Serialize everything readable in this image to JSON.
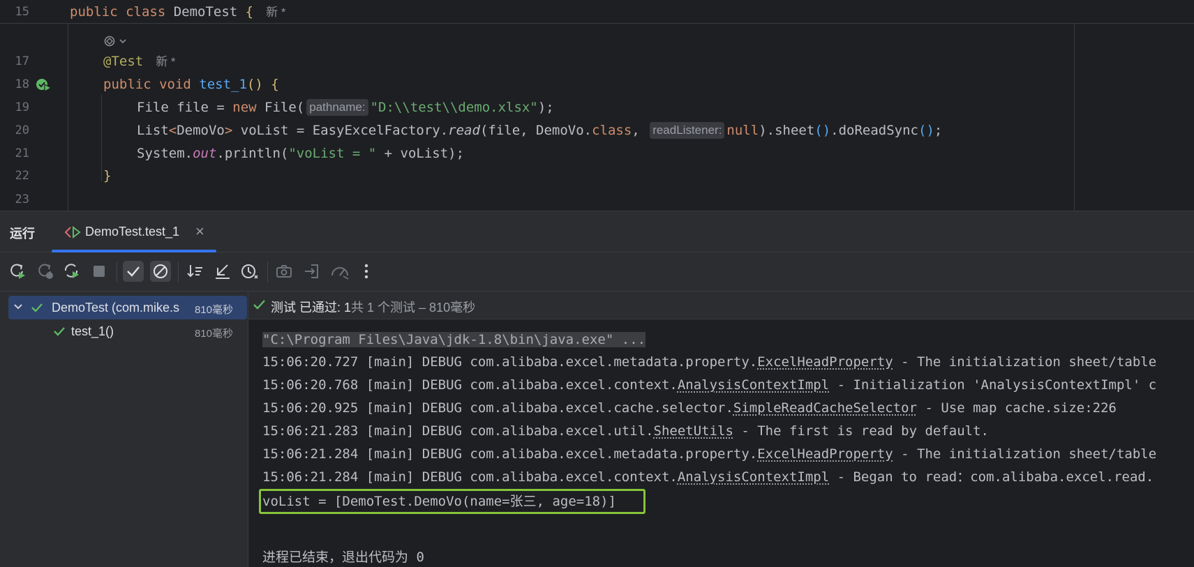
{
  "editor": {
    "lines": [
      {
        "num": "15",
        "tokens": [
          [
            "kw",
            "public class "
          ],
          [
            "plain",
            "DemoTest "
          ],
          [
            "brace",
            "{"
          ]
        ],
        "hint": "新 *"
      },
      {
        "num": "17",
        "tokens": [
          [
            "anno",
            "@Test"
          ]
        ],
        "hint": "新 *"
      },
      {
        "num": "18",
        "tokens": [
          [
            "kw",
            "public void "
          ],
          [
            "fn",
            "test_1"
          ],
          [
            "brace",
            "() {"
          ]
        ]
      },
      {
        "num": "19",
        "tokens": [
          [
            "plain",
            "File file = "
          ],
          [
            "kw",
            "new "
          ],
          [
            "plain",
            "File("
          ],
          [
            "inlay",
            "pathname:"
          ],
          [
            "str",
            "\"D:\\\\test\\\\demo.xlsx\""
          ],
          [
            "plain",
            ");"
          ]
        ]
      },
      {
        "num": "20",
        "tokens": [
          [
            "plain",
            "List"
          ],
          [
            "kw",
            "<"
          ],
          [
            "plain",
            "DemoVo"
          ],
          [
            "kw",
            ">"
          ],
          [
            "plain",
            " voList = EasyExcelFactory."
          ],
          [
            "ital",
            "read"
          ],
          [
            "plain",
            "(file, DemoVo."
          ],
          [
            "kw",
            "class"
          ],
          [
            "plain",
            ", "
          ],
          [
            "inlay",
            "readListener:"
          ],
          [
            "kw",
            "null"
          ],
          [
            "plain",
            ").sheet"
          ],
          [
            "paren",
            "()"
          ],
          [
            "plain",
            ".doReadSync"
          ],
          [
            "paren",
            "()"
          ],
          [
            "plain",
            ";"
          ]
        ]
      },
      {
        "num": "21",
        "tokens": [
          [
            "plain",
            "System."
          ],
          [
            "field",
            "out"
          ],
          [
            "plain",
            ".println("
          ],
          [
            "str",
            "\"voList = \""
          ],
          [
            "plain",
            " + voList);"
          ]
        ]
      },
      {
        "num": "22",
        "tokens": [
          [
            "brace",
            "}"
          ]
        ]
      },
      {
        "num": "23",
        "tokens": []
      }
    ]
  },
  "run_panel": {
    "title": "运行",
    "tab_label": "DemoTest.test_1",
    "tab_close": "×"
  },
  "status": {
    "main": "测试 已通过: ",
    "count": "1",
    "detail": "共 1 个测试 – 810毫秒"
  },
  "tree": {
    "root_label": "DemoTest (com.mike.s",
    "root_time": "810毫秒",
    "child_label": "test_1()",
    "child_time": "810毫秒"
  },
  "console": {
    "command": "\"C:\\Program Files\\Java\\jdk-1.8\\bin\\java.exe\" ...",
    "logs": [
      {
        "prefix": "15:06:20.727 [main] DEBUG com.alibaba.excel.metadata.property.",
        "cls": "ExcelHeadProperty",
        "suffix": " - The initialization sheet/table"
      },
      {
        "prefix": "15:06:20.768 [main] DEBUG com.alibaba.excel.context.",
        "cls": "AnalysisContextImpl",
        "suffix": " - Initialization 'AnalysisContextImpl' c"
      },
      {
        "prefix": "15:06:20.925 [main] DEBUG com.alibaba.excel.cache.selector.",
        "cls": "SimpleReadCacheSelector",
        "suffix": " - Use map cache.size:226"
      },
      {
        "prefix": "15:06:21.283 [main] DEBUG com.alibaba.excel.util.",
        "cls": "SheetUtils",
        "suffix": " - The first is read by default."
      },
      {
        "prefix": "15:06:21.284 [main] DEBUG com.alibaba.excel.metadata.property.",
        "cls": "ExcelHeadProperty",
        "suffix": " - The initialization sheet/table"
      },
      {
        "prefix": "15:06:21.284 [main] DEBUG com.alibaba.excel.context.",
        "cls": "AnalysisContextImpl",
        "suffix": " - Began to read：com.alibaba.excel.read."
      }
    ],
    "result": "voList = [DemoTest.DemoVo(name=张三, age=18)]",
    "exit": "进程已结束，退出代码为 0"
  },
  "colors": {
    "accent": "#3574f0",
    "pass": "#5fb865",
    "highlight_box": "#86c43b"
  }
}
